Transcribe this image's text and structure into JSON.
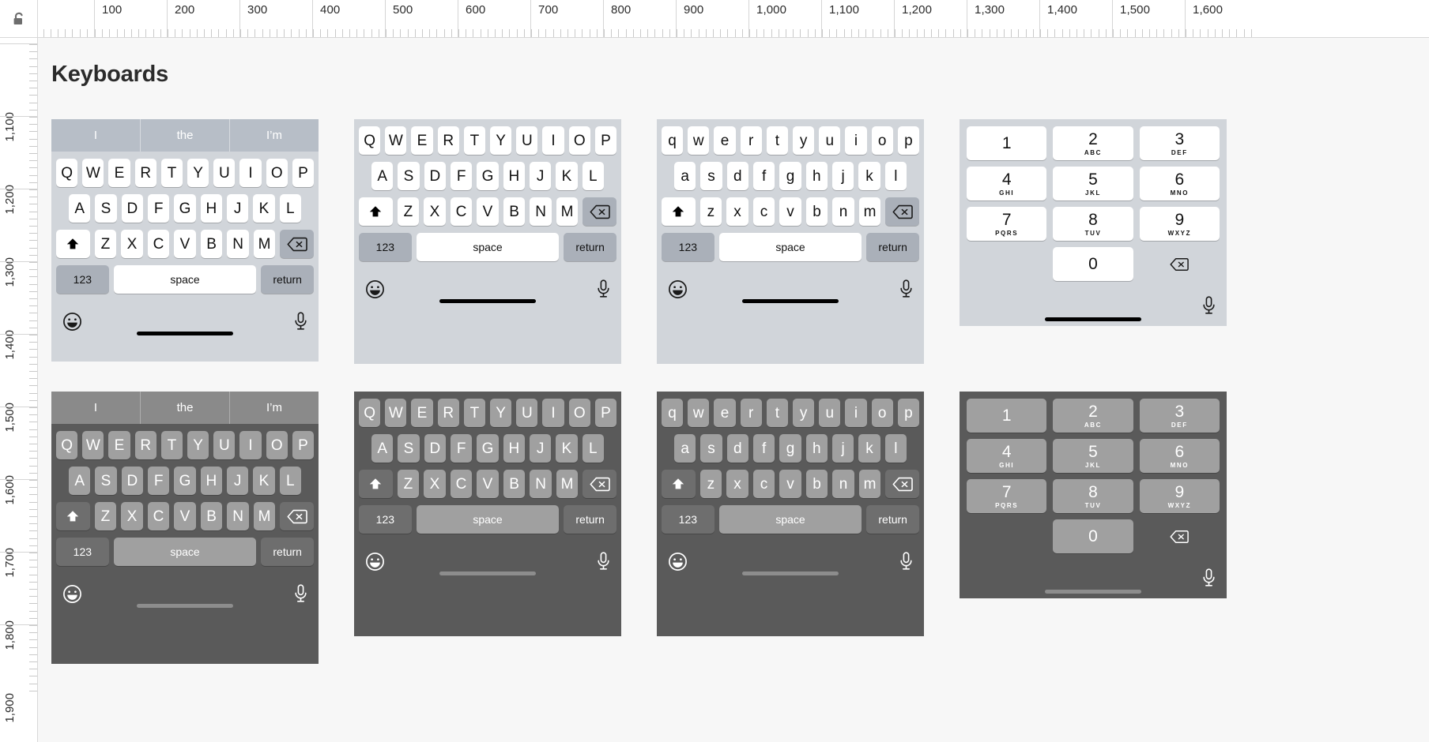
{
  "app": {
    "title": "Keyboards",
    "lock_icon": "unlock-icon"
  },
  "rulers": {
    "horizontal": [
      "100",
      "200",
      "300",
      "400",
      "500",
      "600",
      "700",
      "800",
      "900",
      "1,000",
      "1,100",
      "1,200",
      "1,300",
      "1,400",
      "1,500",
      "1,600"
    ],
    "vertical": [
      "1,100",
      "1,200",
      "1,300",
      "1,400",
      "1,500",
      "1,600",
      "1,700",
      "1,800",
      "1,900"
    ]
  },
  "labels": {
    "space": "space",
    "return": "return",
    "numbers_key": "123",
    "shift_icon": "shift-icon",
    "delete_icon": "delete-icon",
    "emoji_icon": "emoji-icon",
    "mic_icon": "microphone-icon",
    "home_indicator": "home-indicator"
  },
  "predictions": [
    "I",
    "the",
    "I’m"
  ],
  "rows": {
    "upper": [
      [
        "Q",
        "W",
        "E",
        "R",
        "T",
        "Y",
        "U",
        "I",
        "O",
        "P"
      ],
      [
        "A",
        "S",
        "D",
        "F",
        "G",
        "H",
        "J",
        "K",
        "L"
      ],
      [
        "Z",
        "X",
        "C",
        "V",
        "B",
        "N",
        "M"
      ]
    ],
    "lower": [
      [
        "q",
        "w",
        "e",
        "r",
        "t",
        "y",
        "u",
        "i",
        "o",
        "p"
      ],
      [
        "a",
        "s",
        "d",
        "f",
        "g",
        "h",
        "j",
        "k",
        "l"
      ],
      [
        "z",
        "x",
        "c",
        "v",
        "b",
        "n",
        "m"
      ]
    ]
  },
  "numpad": [
    [
      {
        "num": "1",
        "sub": ""
      },
      {
        "num": "2",
        "sub": "ABC"
      },
      {
        "num": "3",
        "sub": "DEF"
      }
    ],
    [
      {
        "num": "4",
        "sub": "GHI"
      },
      {
        "num": "5",
        "sub": "JKL"
      },
      {
        "num": "6",
        "sub": "MNO"
      }
    ],
    [
      {
        "num": "7",
        "sub": "PQRS"
      },
      {
        "num": "8",
        "sub": "TUV"
      },
      {
        "num": "9",
        "sub": "WXYZ"
      }
    ],
    [
      {
        "num": "",
        "sub": ""
      },
      {
        "num": "0",
        "sub": ""
      },
      {
        "num": "delete-icon",
        "sub": ""
      }
    ]
  ],
  "artboards": [
    {
      "name": "qwerty-predictive-light",
      "theme": "light",
      "type": "predictive",
      "case": "upper"
    },
    {
      "name": "qwerty-upper-light",
      "theme": "light",
      "type": "plain",
      "case": "upper"
    },
    {
      "name": "qwerty-lower-light",
      "theme": "light",
      "type": "plain",
      "case": "lower"
    },
    {
      "name": "numpad-light",
      "theme": "light",
      "type": "numpad",
      "case": ""
    },
    {
      "name": "qwerty-predictive-dark",
      "theme": "dark",
      "type": "predictive",
      "case": "upper"
    },
    {
      "name": "qwerty-upper-dark",
      "theme": "dark",
      "type": "plain",
      "case": "upper"
    },
    {
      "name": "qwerty-lower-dark",
      "theme": "dark",
      "type": "plain",
      "case": "lower"
    },
    {
      "name": "numpad-dark",
      "theme": "dark",
      "type": "numpad",
      "case": ""
    }
  ],
  "colors": {
    "canvas": "#f7f7f7",
    "kb_light_bg": "#d1d5da",
    "kb_dark_bg": "#5a5a5a",
    "key_light": "#ffffff",
    "key_dark": "#a0a0a0",
    "fn_light": "#aab0b9",
    "fn_dark": "#6e6e6e",
    "predict_light": "#b7bec7",
    "predict_dark": "#8a8a8a"
  }
}
